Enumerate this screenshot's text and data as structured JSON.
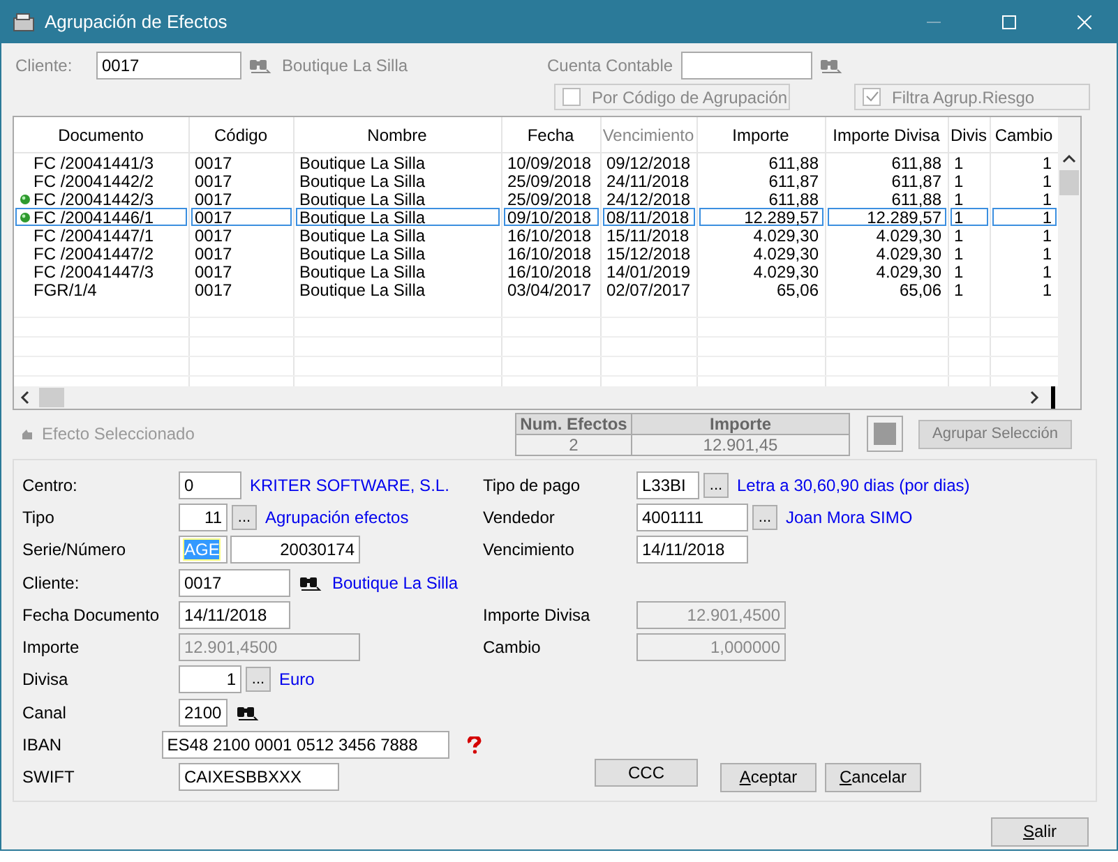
{
  "window": {
    "title": "Agrupación de Efectos"
  },
  "filter": {
    "client_label": "Cliente:",
    "client_value": "0017",
    "client_name": "Boutique La Silla",
    "account_label": "Cuenta Contable",
    "group_by_code": {
      "label": "Por Código de Agrupación",
      "checked": false,
      "disabled": true
    },
    "risk_filter": {
      "label": "Filtra Agrup.Riesgo",
      "checked": true,
      "disabled": true
    }
  },
  "table": {
    "columns": [
      {
        "label": "Documento",
        "disabled": false
      },
      {
        "label": "Código",
        "disabled": false
      },
      {
        "label": "Nombre",
        "disabled": false
      },
      {
        "label": "Fecha",
        "disabled": false
      },
      {
        "label": "Vencimiento",
        "disabled": true
      },
      {
        "label": "Importe",
        "disabled": false
      },
      {
        "label": "Importe Divisa",
        "disabled": false
      },
      {
        "label": "Divis",
        "disabled": false
      },
      {
        "label": "Cambio",
        "disabled": false
      }
    ],
    "rows": [
      {
        "cells": [
          "FC /20041441/3",
          "0017",
          "Boutique La Silla",
          "10/09/2018",
          "09/12/2018",
          "611,88",
          "611,88",
          "1",
          "1"
        ],
        "marked": false,
        "selected": false
      },
      {
        "cells": [
          "FC /20041442/2",
          "0017",
          "Boutique La Silla",
          "25/09/2018",
          "24/11/2018",
          "611,87",
          "611,87",
          "1",
          "1"
        ],
        "marked": false,
        "selected": false
      },
      {
        "cells": [
          "FC /20041442/3",
          "0017",
          "Boutique La Silla",
          "25/09/2018",
          "24/12/2018",
          "611,88",
          "611,88",
          "1",
          "1"
        ],
        "marked": true,
        "selected": false
      },
      {
        "cells": [
          "FC /20041446/1",
          "0017",
          "Boutique La Silla",
          "09/10/2018",
          "08/11/2018",
          "12.289,57",
          "12.289,57",
          "1",
          "1"
        ],
        "marked": true,
        "selected": true
      },
      {
        "cells": [
          "FC /20041447/1",
          "0017",
          "Boutique La Silla",
          "16/10/2018",
          "15/11/2018",
          "4.029,30",
          "4.029,30",
          "1",
          "1"
        ],
        "marked": false,
        "selected": false
      },
      {
        "cells": [
          "FC /20041447/2",
          "0017",
          "Boutique La Silla",
          "16/10/2018",
          "15/12/2018",
          "4.029,30",
          "4.029,30",
          "1",
          "1"
        ],
        "marked": false,
        "selected": false
      },
      {
        "cells": [
          "FC /20041447/3",
          "0017",
          "Boutique La Silla",
          "16/10/2018",
          "14/01/2019",
          "4.029,30",
          "4.029,30",
          "1",
          "1"
        ],
        "marked": false,
        "selected": false
      },
      {
        "cells": [
          "FGR/1/4",
          "0017",
          "Boutique La Silla",
          "03/04/2017",
          "02/07/2017",
          "65,06",
          "65,06",
          "1",
          "1"
        ],
        "marked": false,
        "selected": false
      }
    ]
  },
  "selection": {
    "label": "Efecto Seleccionado",
    "disabled": true
  },
  "summary": {
    "columns": [
      "Num. Efectos",
      "Importe"
    ],
    "values": [
      "2",
      "12.901,45"
    ]
  },
  "group_button": {
    "label": "Agrupar Selección",
    "disabled": true
  },
  "form": {
    "rows": [
      {
        "left": {
          "label": "Centro:",
          "value": "0",
          "link": "KRITER SOFTWARE, S.L."
        },
        "right": {
          "label": "Tipo de pago",
          "value": "L33BI",
          "picker": "...",
          "link": "Letra a 30,60,90 dias (por dias)"
        }
      },
      {
        "left": {
          "label": "Tipo",
          "value": "11",
          "picker": "...",
          "link": "Agrupación efectos"
        },
        "right": {
          "label": "Vendedor",
          "value": "4001111",
          "picker": "...",
          "link": "Joan Mora SIMO"
        }
      },
      {
        "left": {
          "label": "Serie/Número",
          "value": "AGE",
          "highlighted": true,
          "value2": "20030174"
        },
        "right": {
          "label": "Vencimiento",
          "value": "14/11/2018"
        }
      },
      {
        "left": {
          "label": "Cliente:",
          "value": "0017",
          "search": true,
          "link": "Boutique La Silla"
        }
      },
      {
        "left": {
          "label": "Fecha Documento",
          "value": "14/11/2018"
        },
        "right": {
          "label": "Importe Divisa",
          "value": "12.901,4500",
          "readonly": true
        }
      },
      {
        "left": {
          "label": "Importe",
          "value": "12.901,4500",
          "readonly": true
        },
        "right": {
          "label": "Cambio",
          "value": "1,000000",
          "readonly": true
        }
      },
      {
        "left": {
          "label": "Divisa",
          "value": "1",
          "picker": "...",
          "link": "Euro"
        }
      },
      {
        "left": {
          "label": "Canal",
          "value": "2100",
          "search": true
        }
      },
      {
        "left": {
          "label": "IBAN",
          "value": "ES48 2100 0001 0512 3456 7888",
          "help": true
        }
      },
      {
        "left": {
          "label": "SWIFT",
          "value": "CAIXESBBXXX"
        }
      }
    ],
    "buttons": [
      {
        "label": "CCC",
        "underline_first": false
      },
      {
        "label": "Aceptar",
        "underline_first": true
      },
      {
        "label": "Cancelar",
        "underline_first": true
      }
    ]
  },
  "footer_button": {
    "label": "Salir",
    "underline_first": true
  }
}
